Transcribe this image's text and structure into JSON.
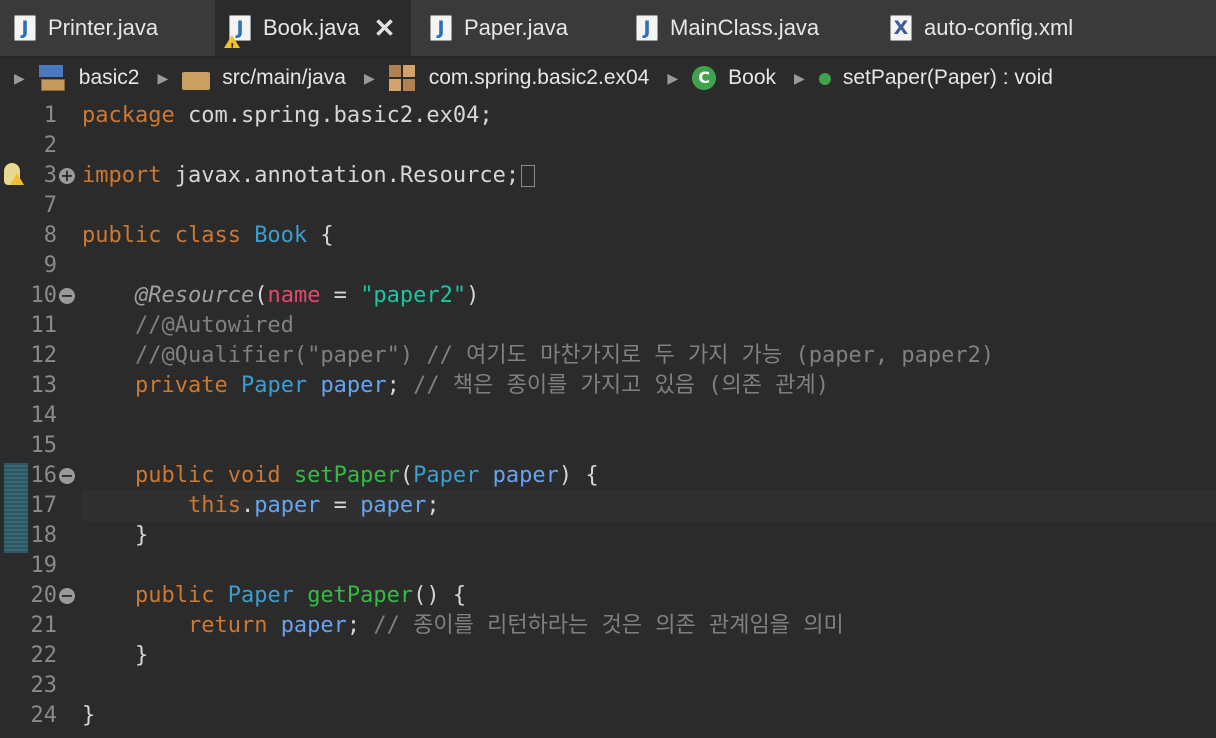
{
  "tabs": [
    {
      "label": "Printer.java",
      "icon": "java-file-icon",
      "active": false
    },
    {
      "label": "Book.java",
      "icon": "java-file-warning-icon",
      "active": true
    },
    {
      "label": "Paper.java",
      "icon": "java-file-icon",
      "active": false
    },
    {
      "label": "MainClass.java",
      "icon": "java-file-icon",
      "active": false
    },
    {
      "label": "auto-config.xml",
      "icon": "xml-file-icon",
      "active": false
    }
  ],
  "breadcrumb": {
    "project": "basic2",
    "source_folder": "src/main/java",
    "package": "com.spring.basic2.ex04",
    "class": "Book",
    "method": "setPaper(Paper) : void"
  },
  "editor": {
    "lines": [
      {
        "n": "1",
        "tokens": [
          [
            "k",
            "package"
          ],
          [
            "p",
            " com.spring.basic2.ex04;"
          ]
        ]
      },
      {
        "n": "2",
        "tokens": []
      },
      {
        "n": "3",
        "tokens": [
          [
            "k",
            "import"
          ],
          [
            "p",
            " javax.annotation.Resource;"
          ]
        ]
      },
      {
        "n": "7",
        "tokens": []
      },
      {
        "n": "8",
        "tokens": [
          [
            "k",
            "public class "
          ],
          [
            "cls",
            "Book"
          ],
          [
            "p",
            " {"
          ]
        ]
      },
      {
        "n": "9",
        "tokens": []
      },
      {
        "n": "10",
        "tokens": [
          [
            "p",
            "    "
          ],
          [
            "ann",
            "@Resource"
          ],
          [
            "p",
            "("
          ],
          [
            "an",
            "name"
          ],
          [
            "p",
            " = "
          ],
          [
            "str",
            "\"paper2\""
          ],
          [
            "p",
            ")"
          ]
        ]
      },
      {
        "n": "11",
        "tokens": [
          [
            "cmt",
            "    //@Autowired"
          ]
        ]
      },
      {
        "n": "12",
        "tokens": [
          [
            "cmt",
            "    //@Qualifier(\"paper\") // 여기도 마찬가지로 두 가지 가능 (paper, paper2)"
          ]
        ]
      },
      {
        "n": "13",
        "tokens": [
          [
            "p",
            "    "
          ],
          [
            "k",
            "private "
          ],
          [
            "cls",
            "Paper "
          ],
          [
            "fld",
            "paper"
          ],
          [
            "p",
            "; "
          ],
          [
            "cmt",
            "// 책은 종이를 가지고 있음 (의존 관계)"
          ]
        ]
      },
      {
        "n": "14",
        "tokens": []
      },
      {
        "n": "15",
        "tokens": []
      },
      {
        "n": "16",
        "tokens": [
          [
            "p",
            "    "
          ],
          [
            "k",
            "public void "
          ],
          [
            "mth",
            "setPaper"
          ],
          [
            "p",
            "("
          ],
          [
            "cls",
            "Paper "
          ],
          [
            "fld",
            "paper"
          ],
          [
            "p",
            ") {"
          ]
        ]
      },
      {
        "n": "17",
        "tokens": [
          [
            "p",
            "        "
          ],
          [
            "k",
            "this"
          ],
          [
            "p",
            "."
          ],
          [
            "fld",
            "paper"
          ],
          [
            "p",
            " = "
          ],
          [
            "fld",
            "paper"
          ],
          [
            "p",
            ";"
          ]
        ]
      },
      {
        "n": "18",
        "tokens": [
          [
            "p",
            "    }"
          ]
        ]
      },
      {
        "n": "19",
        "tokens": []
      },
      {
        "n": "20",
        "tokens": [
          [
            "p",
            "    "
          ],
          [
            "k",
            "public "
          ],
          [
            "cls",
            "Paper "
          ],
          [
            "mth",
            "getPaper"
          ],
          [
            "p",
            "() {"
          ]
        ]
      },
      {
        "n": "21",
        "tokens": [
          [
            "p",
            "        "
          ],
          [
            "k",
            "return "
          ],
          [
            "fld",
            "paper"
          ],
          [
            "p",
            "; "
          ],
          [
            "cmt",
            "// 종이를 리턴하라는 것은 의존 관계임을 의미"
          ]
        ]
      },
      {
        "n": "22",
        "tokens": [
          [
            "p",
            "    }"
          ]
        ]
      },
      {
        "n": "23",
        "tokens": []
      },
      {
        "n": "24",
        "tokens": [
          [
            "p",
            "}"
          ]
        ]
      }
    ]
  }
}
